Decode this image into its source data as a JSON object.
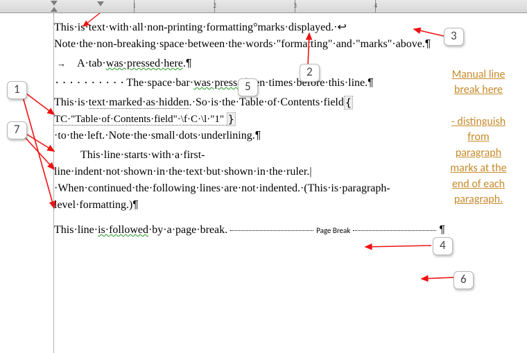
{
  "ruler": {
    "numbers": [
      "1",
      "2",
      "3",
      "4"
    ]
  },
  "body": {
    "p1_a": "This·is·text·with·all·non-printing·formatting",
    "p1_nbsp": "°",
    "p1_b": "marks·displayed.·",
    "p1_lb": "↩",
    "p2": "Note·the·non-breaking·space·between·the·words·\"formatting\"·and·\"marks\"·above.",
    "pil": "¶",
    "p3": "A·tab·",
    "p3b": "was·pressed·here",
    "p3c": ".",
    "p4_dots": "··········",
    "p4_a": "The·space·bar·",
    "p4_b": "was·pressed",
    "p4_c": "·ten·times·before·this·line.",
    "p5_a": "This·is·",
    "p5_hidden": "text·marked·as·hidden",
    "p5_b": ".·So·is·the·Table·of·Contents·field",
    "p5_code": " TC·\"Table·of·Contents·field\"·\\f·C·\\l·\"1\" ",
    "p5_c": "·to·the·left.·Note·the·small·dots·underlining.",
    "p6": "This·line·starts·with·a·first-line·indent·not·shown·in·the·text·but·shown·in·the·ruler.|·When·continued·the·following·lines·are·not·indented.·(This·is·paragraph-level·formatting.)",
    "p7_a": "This·line·",
    "p7_b": "is·followed",
    "p7_c": "·by·a·page·break.",
    "page_break_label": "Page Break"
  },
  "callouts": {
    "c1": "1",
    "c2": "2",
    "c3": "3",
    "c4": "4",
    "c5": "5",
    "c6": "6",
    "c7": "7"
  },
  "annotations": {
    "line1": "Manual line",
    "line2": "break here",
    "l3": "- distinguish",
    "l4": "from",
    "l5": "paragraph",
    "l6": "marks at the",
    "l7": "end of each",
    "l8": "paragraph."
  }
}
